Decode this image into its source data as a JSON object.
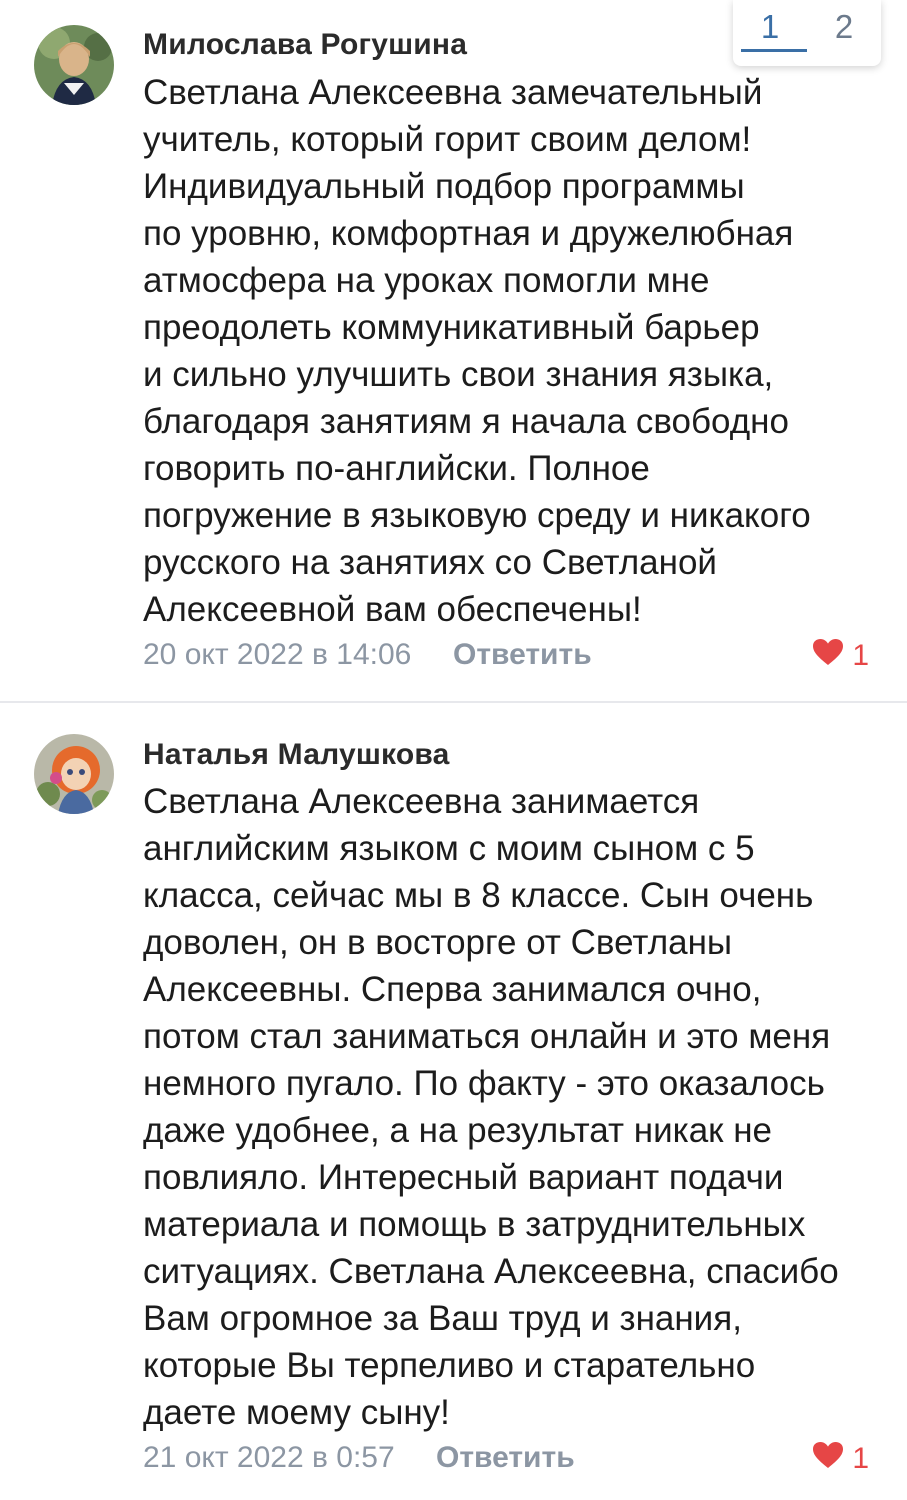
{
  "pagination": {
    "pages": [
      "1",
      "2"
    ],
    "active": "1"
  },
  "comments": [
    {
      "author": "Милослава Рогушина",
      "lines": [
        "Светлана Алексеевна замечательный",
        "учитель, который горит своим делом!",
        "Индивидуальный подбор программы",
        "по уровню, комфортная и дружелюбная",
        "атмосфера на уроках помогли мне",
        "преодолеть коммуникативный барьер",
        "и сильно улучшить свои знания языка,",
        "благодаря занятиям я начала свободно",
        "говорить по-английски. Полное",
        "погружение в языковую среду и никакого",
        "русского на занятиях со Светланой",
        "Алексеевной вам обеспечены!"
      ],
      "date": "20 окт 2022 в 14:06",
      "reply_label": "Ответить",
      "likes": "1"
    },
    {
      "author": "Наталья Малушкова",
      "lines": [
        "Светлана Алексеевна занимается",
        "английским языком с моим сыном с 5",
        "класса, сейчас мы в 8 классе. Сын очень",
        "доволен, он в восторге от Светланы",
        "Алексеевны. Сперва занимался очно,",
        "потом стал заниматься онлайн и это меня",
        "немного пугало. По факту - это оказалось",
        "даже удобнее, а на результат никак не",
        "повлияло. Интересный вариант подачи",
        "материала и помощь в затруднительных",
        "ситуациях. Светлана Алексеевна, спасибо",
        "Вам огромное за Ваш труд и знания,",
        "которые Вы терпеливо и старательно",
        "даете моему сыну!"
      ],
      "date": "21 окт 2022 в 0:57",
      "reply_label": "Ответить",
      "likes": "1"
    }
  ],
  "colors": {
    "like": "#e64646",
    "meta": "#8c96a3",
    "pager_active": "#3a6fa6"
  }
}
